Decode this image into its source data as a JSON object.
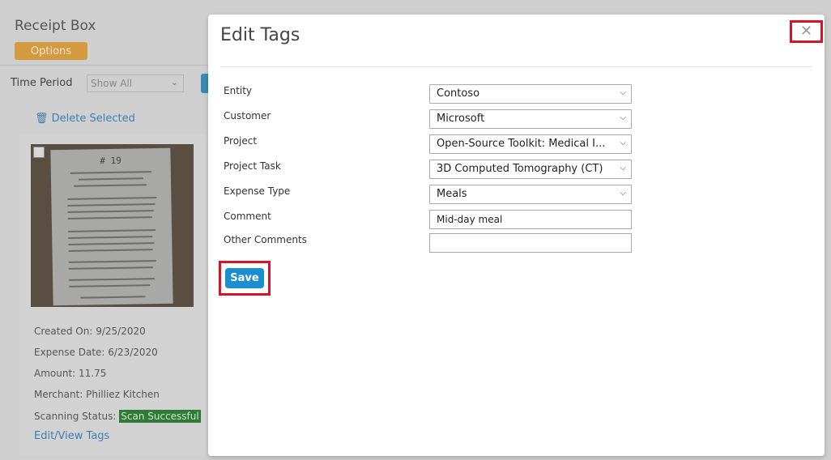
{
  "background": {
    "app_title": "Receipt Box",
    "options_label": "Options",
    "time_period_label": "Time Period",
    "time_period_value": "Show All",
    "delete_selected_label": "Delete Selected",
    "card": {
      "created_on": "Created On: 9/25/2020",
      "expense_date": "Expense Date: 6/23/2020",
      "amount": "Amount: 11.75",
      "merchant": "Merchant: Philliez Kitchen",
      "scanning_status_label": "Scanning Status:",
      "scanning_status_value": "Scan Successful",
      "edit_link": "Edit/View Tags",
      "receipt_number": "# 19"
    }
  },
  "modal": {
    "title": "Edit Tags",
    "close_symbol": "✕",
    "fields": {
      "entity": {
        "label": "Entity",
        "value": "Contoso"
      },
      "customer": {
        "label": "Customer",
        "value": "Microsoft"
      },
      "project": {
        "label": "Project",
        "value": "Open-Source Toolkit: Medical I..."
      },
      "project_task": {
        "label": "Project Task",
        "value": "3D Computed Tomography (CT)"
      },
      "expense_type": {
        "label": "Expense Type",
        "value": "Meals"
      },
      "comment": {
        "label": "Comment",
        "value": "Mid-day meal"
      },
      "other_comments": {
        "label": "Other Comments",
        "value": ""
      }
    },
    "save_label": "Save"
  },
  "colors": {
    "highlight": "#d9142a",
    "save_button": "#1a8fcf",
    "options_button": "#d49a40",
    "scan_badge": "#2f7a35"
  },
  "icons": {
    "trash": "trash-icon",
    "close": "close-icon",
    "chevron": "chevron-down-icon"
  }
}
